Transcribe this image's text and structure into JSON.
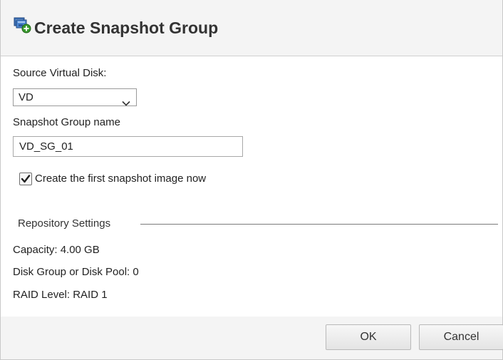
{
  "dialog": {
    "title": "Create Snapshot Group",
    "title_icon": "snapshot-add-icon"
  },
  "source_disk": {
    "label": "Source Virtual Disk:",
    "selected": "VD"
  },
  "group_name": {
    "label": "Snapshot Group name",
    "value": "VD_SG_01"
  },
  "first_image": {
    "label": "Create the first snapshot image now",
    "checked": true
  },
  "repository": {
    "title": "Repository Settings",
    "capacity": "Capacity: 4.00 GB",
    "disk_group": "Disk Group or Disk Pool: 0",
    "raid_level": "RAID Level: RAID 1"
  },
  "buttons": {
    "ok": "OK",
    "cancel": "Cancel"
  }
}
